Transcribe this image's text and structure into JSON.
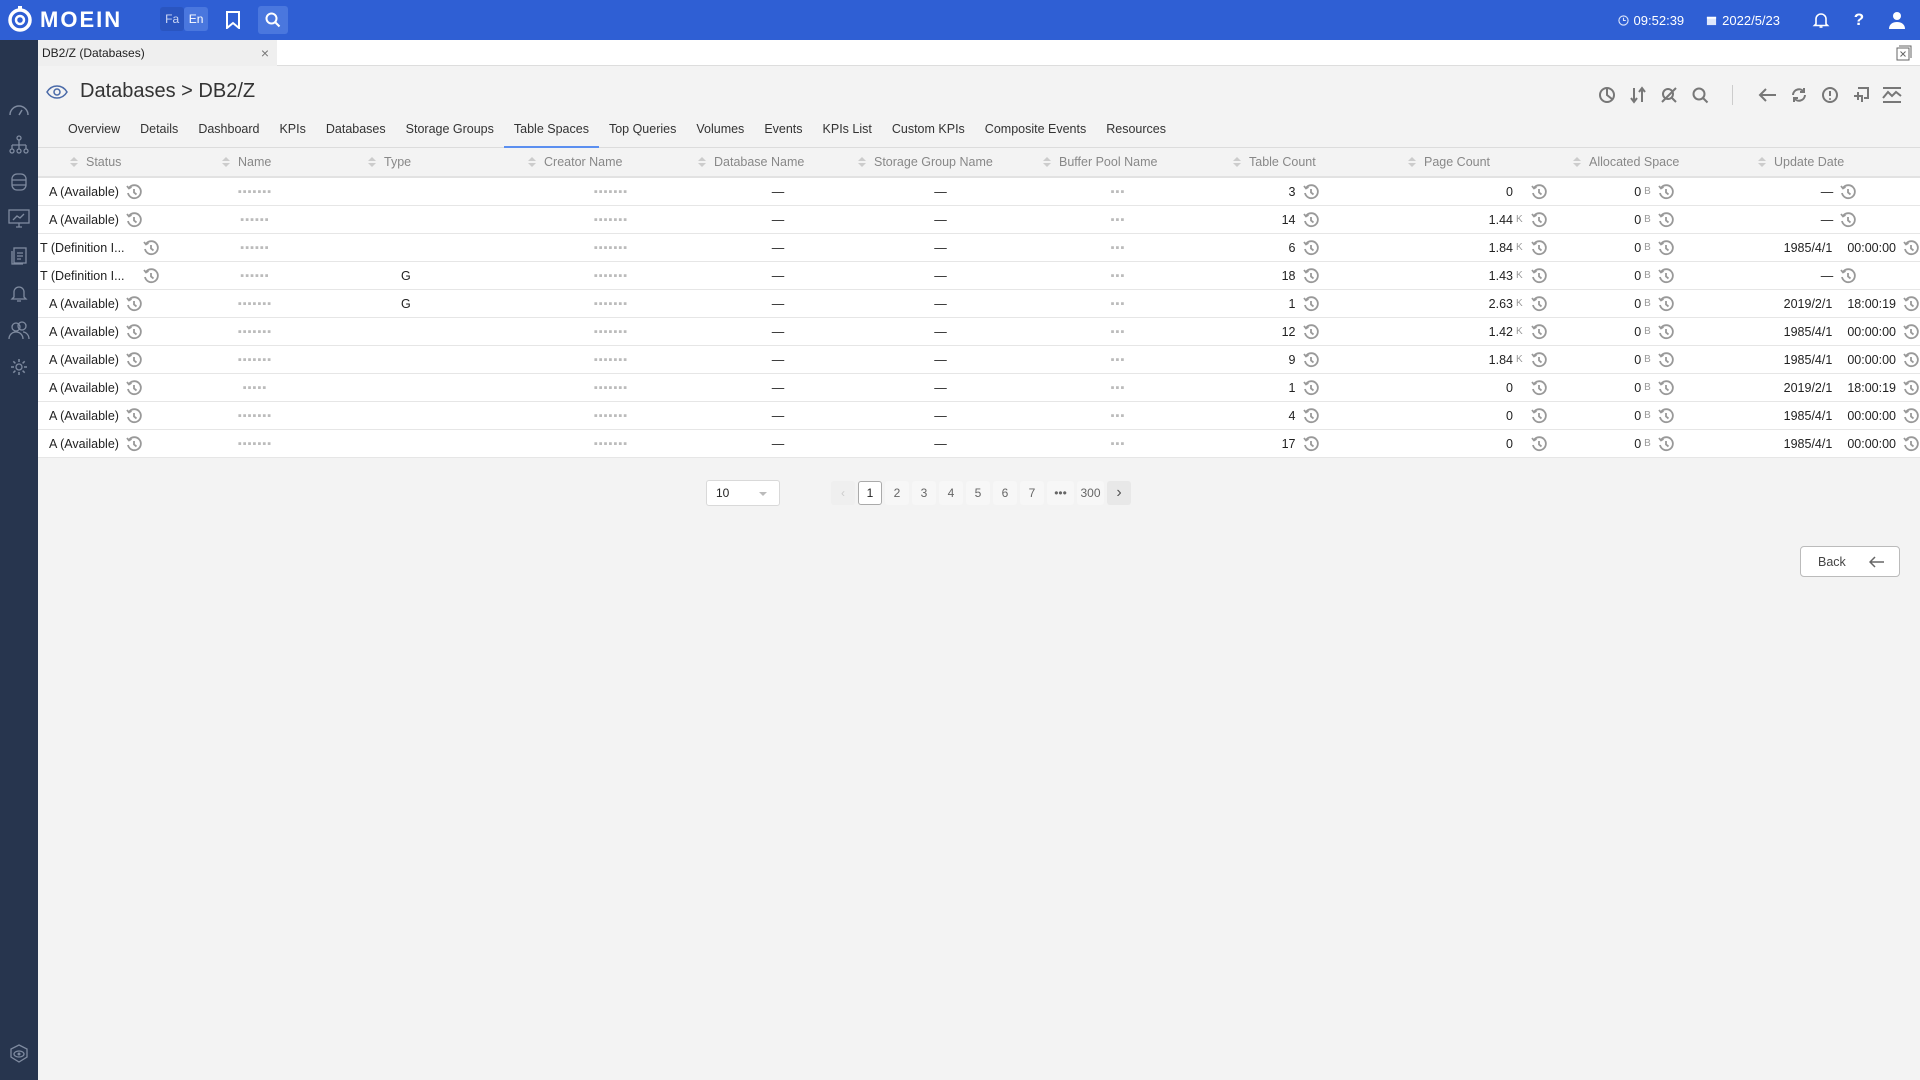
{
  "topbar": {
    "brand": "MOEIN",
    "lang_fa": "Fa",
    "lang_en": "En",
    "time": "09:52:39",
    "date": "2022/5/23"
  },
  "doc_tab": {
    "label": "DB2/Z (Databases)",
    "close": "×"
  },
  "page_title": "Databases > DB2/Z",
  "nav_tabs": [
    {
      "label": "Overview"
    },
    {
      "label": "Details"
    },
    {
      "label": "Dashboard"
    },
    {
      "label": "KPIs"
    },
    {
      "label": "Databases"
    },
    {
      "label": "Storage Groups"
    },
    {
      "label": "Table Spaces",
      "active": true
    },
    {
      "label": "Top Queries"
    },
    {
      "label": "Volumes"
    },
    {
      "label": "Events"
    },
    {
      "label": "KPIs List"
    },
    {
      "label": "Custom KPIs"
    },
    {
      "label": "Composite Events"
    },
    {
      "label": "Resources"
    }
  ],
  "table": {
    "columns": [
      "Status",
      "Name",
      "Type",
      "Creator Name",
      "Database Name",
      "Storage Group Name",
      "Buffer Pool Name",
      "Table Count",
      "Page Count",
      "Allocated Space",
      "Update Date"
    ],
    "rows": [
      {
        "status": "A (Available)",
        "name": "▪▪▪▪▪▪▪",
        "type": "",
        "creator": "▪▪▪▪▪▪▪",
        "db": "—",
        "sg": "—",
        "bp": "▪▪▪",
        "table_count": "3",
        "page_count": "0",
        "page_unit": "",
        "alloc": "0",
        "alloc_unit": "B",
        "date": "—",
        "time": ""
      },
      {
        "status": "A (Available)",
        "name": "▪▪▪▪▪▪",
        "type": "",
        "creator": "▪▪▪▪▪▪▪",
        "db": "—",
        "sg": "—",
        "bp": "▪▪▪",
        "table_count": "14",
        "page_count": "1.44",
        "page_unit": "K",
        "alloc": "0",
        "alloc_unit": "B",
        "date": "—",
        "time": ""
      },
      {
        "status": "T (Definition I...",
        "name": "▪▪▪▪▪▪",
        "type": "",
        "creator": "▪▪▪▪▪▪▪",
        "db": "—",
        "sg": "—",
        "bp": "▪▪▪",
        "table_count": "6",
        "page_count": "1.84",
        "page_unit": "K",
        "alloc": "0",
        "alloc_unit": "B",
        "date": "1985/4/1",
        "time": "00:00:00"
      },
      {
        "status": "T (Definition I...",
        "name": "▪▪▪▪▪▪",
        "type": "G",
        "creator": "▪▪▪▪▪▪▪",
        "db": "—",
        "sg": "—",
        "bp": "▪▪▪",
        "table_count": "18",
        "page_count": "1.43",
        "page_unit": "K",
        "alloc": "0",
        "alloc_unit": "B",
        "date": "—",
        "time": ""
      },
      {
        "status": "A (Available)",
        "name": "▪▪▪▪▪▪▪",
        "type": "G",
        "creator": "▪▪▪▪▪▪▪",
        "db": "—",
        "sg": "—",
        "bp": "▪▪▪",
        "table_count": "1",
        "page_count": "2.63",
        "page_unit": "K",
        "alloc": "0",
        "alloc_unit": "B",
        "date": "2019/2/1",
        "time": "18:00:19"
      },
      {
        "status": "A (Available)",
        "name": "▪▪▪▪▪▪▪",
        "type": "",
        "creator": "▪▪▪▪▪▪▪",
        "db": "—",
        "sg": "—",
        "bp": "▪▪▪",
        "table_count": "12",
        "page_count": "1.42",
        "page_unit": "K",
        "alloc": "0",
        "alloc_unit": "B",
        "date": "1985/4/1",
        "time": "00:00:00"
      },
      {
        "status": "A (Available)",
        "name": "▪▪▪▪▪▪▪",
        "type": "",
        "creator": "▪▪▪▪▪▪▪",
        "db": "—",
        "sg": "—",
        "bp": "▪▪▪",
        "table_count": "9",
        "page_count": "1.84",
        "page_unit": "K",
        "alloc": "0",
        "alloc_unit": "B",
        "date": "1985/4/1",
        "time": "00:00:00"
      },
      {
        "status": "A (Available)",
        "name": "▪▪▪▪▪",
        "type": "",
        "creator": "▪▪▪▪▪▪▪",
        "db": "—",
        "sg": "—",
        "bp": "▪▪▪",
        "table_count": "1",
        "page_count": "0",
        "page_unit": "",
        "alloc": "0",
        "alloc_unit": "B",
        "date": "2019/2/1",
        "time": "18:00:19"
      },
      {
        "status": "A (Available)",
        "name": "▪▪▪▪▪▪▪",
        "type": "",
        "creator": "▪▪▪▪▪▪▪",
        "db": "—",
        "sg": "—",
        "bp": "▪▪▪",
        "table_count": "4",
        "page_count": "0",
        "page_unit": "",
        "alloc": "0",
        "alloc_unit": "B",
        "date": "1985/4/1",
        "time": "00:00:00"
      },
      {
        "status": "A (Available)",
        "name": "▪▪▪▪▪▪▪",
        "type": "",
        "creator": "▪▪▪▪▪▪▪",
        "db": "—",
        "sg": "—",
        "bp": "▪▪▪",
        "table_count": "17",
        "page_count": "0",
        "page_unit": "",
        "alloc": "0",
        "alloc_unit": "B",
        "date": "1985/4/1",
        "time": "00:00:00"
      }
    ]
  },
  "pagination": {
    "page_size": "10",
    "pages": [
      "1",
      "2",
      "3",
      "4",
      "5",
      "6",
      "7",
      "•••",
      "300"
    ],
    "current": "1"
  },
  "back_button": "Back"
}
